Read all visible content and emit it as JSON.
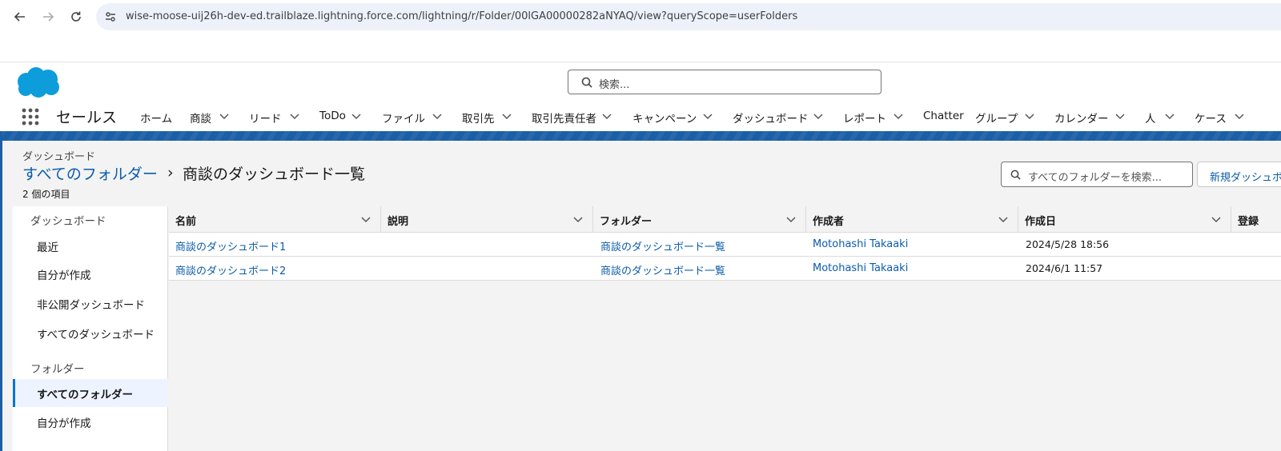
{
  "browser": {
    "url": "wise-moose-uij26h-dev-ed.trailblaze.lightning.force.com/lightning/r/Folder/00lGA00000282aNYAQ/view?queryScope=userFolders"
  },
  "header": {
    "search_placeholder": "検索..."
  },
  "nav": {
    "app_name": "セールス",
    "items": [
      {
        "label": "ホーム"
      },
      {
        "label": "商談"
      },
      {
        "label": "リード"
      },
      {
        "label": "ToDo"
      },
      {
        "label": "ファイル"
      },
      {
        "label": "取引先"
      },
      {
        "label": "取引先責任者"
      },
      {
        "label": "キャンペーン"
      },
      {
        "label": "ダッシュボード"
      },
      {
        "label": "レポート"
      },
      {
        "label": "Chatter"
      },
      {
        "label": "グループ"
      },
      {
        "label": "カレンダー"
      },
      {
        "label": "人"
      },
      {
        "label": "ケース"
      }
    ]
  },
  "page": {
    "object_label": "ダッシュボード",
    "breadcrumb_link": "すべてのフォルダー",
    "breadcrumb_sep": "›",
    "title": "商談のダッシュボード一覧",
    "item_count": "2 個の項目",
    "folder_search_placeholder": "すべてのフォルダーを検索...",
    "new_button": "新規ダッシュボード"
  },
  "sidebar": {
    "section_dashboards": "ダッシュボード",
    "dashboard_items": [
      {
        "label": "最近"
      },
      {
        "label": "自分が作成"
      },
      {
        "label": "非公開ダッシュボード"
      },
      {
        "label": "すべてのダッシュボード"
      }
    ],
    "section_folders": "フォルダー",
    "folder_items": [
      {
        "label": "すべてのフォルダー",
        "active": true
      },
      {
        "label": "自分が作成"
      }
    ]
  },
  "table": {
    "columns": [
      "名前",
      "説明",
      "フォルダー",
      "作成者",
      "作成日",
      "登録"
    ],
    "rows": [
      {
        "name": "商談のダッシュボード1",
        "description": "",
        "folder": "商談のダッシュボード一覧",
        "created_by": "Motohashi Takaaki",
        "created_date": "2024/5/28 18:56"
      },
      {
        "name": "商談のダッシュボード2",
        "description": "",
        "folder": "商談のダッシュボード一覧",
        "created_by": "Motohashi Takaaki",
        "created_date": "2024/6/1 11:57"
      }
    ]
  },
  "colors": {
    "accent": "#0176d3",
    "link": "#0b5cab",
    "brand_blue": "#1b5fa6",
    "logo": "#0d9dda"
  }
}
